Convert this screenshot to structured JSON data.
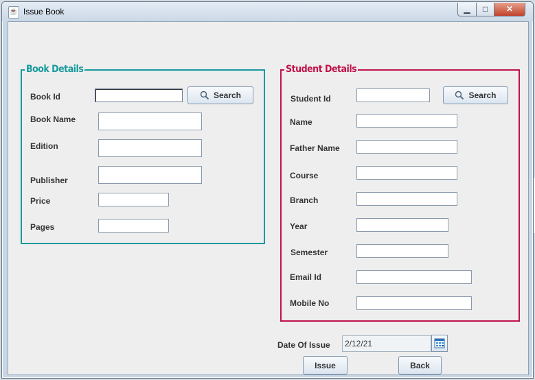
{
  "window": {
    "title": "Issue Book",
    "controls": {
      "minimize": "▁",
      "maximize": "□",
      "close": "✕"
    }
  },
  "book_details": {
    "legend": "Book Details",
    "fields": [
      {
        "label": "Book Id",
        "value": ""
      },
      {
        "label": "Book Name",
        "value": ""
      },
      {
        "label": "Edition",
        "value": ""
      },
      {
        "label": "Publisher",
        "value": ""
      },
      {
        "label": "Price",
        "value": ""
      },
      {
        "label": "Pages",
        "value": ""
      }
    ],
    "search_label": "Search"
  },
  "student_details": {
    "legend": "Student Details",
    "fields": [
      {
        "label": "Student Id",
        "value": ""
      },
      {
        "label": "Name",
        "value": ""
      },
      {
        "label": "Father Name",
        "value": ""
      },
      {
        "label": "Course",
        "value": ""
      },
      {
        "label": "Branch",
        "value": ""
      },
      {
        "label": "Year",
        "value": ""
      },
      {
        "label": "Semester",
        "value": ""
      },
      {
        "label": "Email Id",
        "value": ""
      },
      {
        "label": "Mobile No",
        "value": ""
      }
    ],
    "search_label": "Search"
  },
  "issue": {
    "date_label": "Date Of Issue",
    "date_value": "2/12/21"
  },
  "actions": {
    "issue_label": "Issue",
    "back_label": "Back"
  },
  "colors": {
    "book_accent": "#17999c",
    "student_accent": "#c0124a"
  }
}
